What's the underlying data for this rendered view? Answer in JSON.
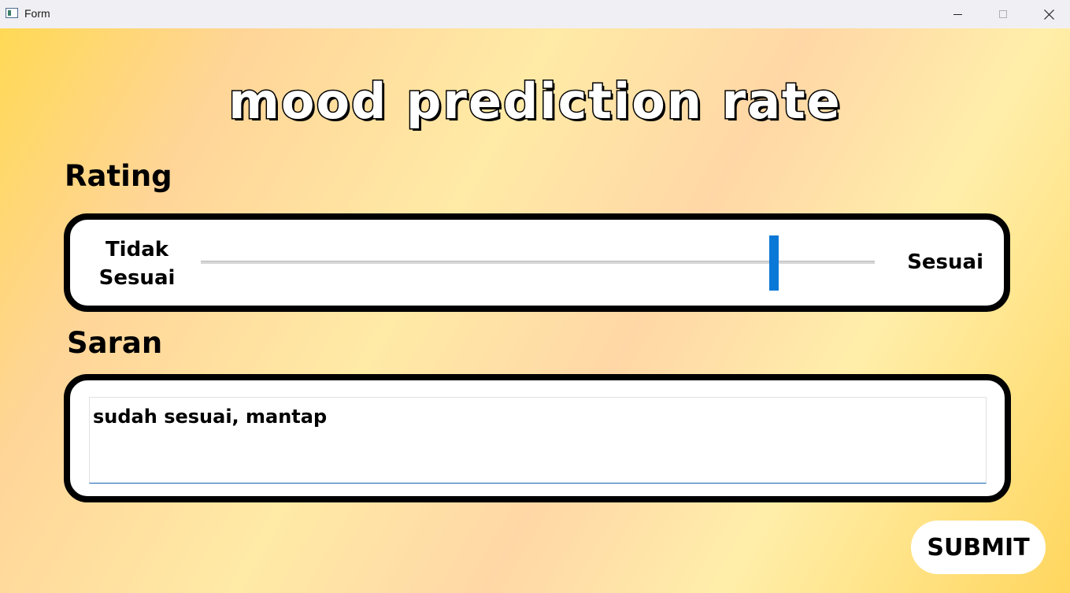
{
  "window": {
    "title": "Form",
    "controls": [
      "minimize-icon",
      "maximize-icon",
      "close-icon"
    ]
  },
  "header": {
    "title": "mood prediction rate"
  },
  "rating": {
    "label": "Rating",
    "slider": {
      "min_label": "Tidak Sesuai",
      "max_label": "Sesuai",
      "value": 0.85
    }
  },
  "saran": {
    "label": "Saran",
    "text_value": "sudah sesuai, mantap"
  },
  "actions": {
    "submit_label": "SUBMIT"
  },
  "colors": {
    "accent": "#0a78d7",
    "background_gradient": [
      "#ffd955",
      "#ffd598",
      "#ffeaa6",
      "#ffd65e"
    ]
  }
}
